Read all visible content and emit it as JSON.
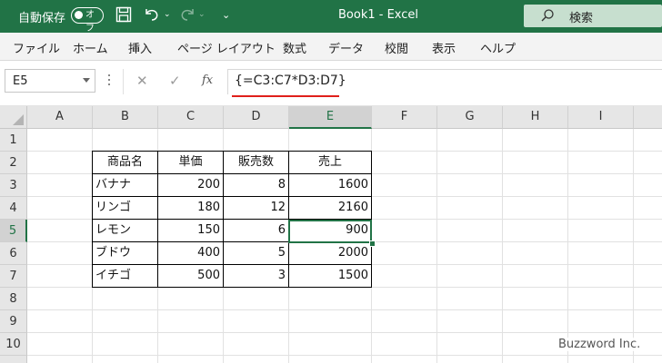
{
  "titlebar": {
    "autosave_label": "自動保存",
    "toggle_state": "オフ",
    "doc_title": "Book1  -  Excel",
    "search_placeholder": "検索"
  },
  "ribbon": {
    "tabs": [
      "ファイル",
      "ホーム",
      "挿入",
      "ページ レイアウト",
      "数式",
      "データ",
      "校閲",
      "表示",
      "ヘルプ"
    ]
  },
  "formula_bar": {
    "name_box": "E5",
    "cancel_icon": "✕",
    "enter_icon": "✓",
    "fx_label": "fx",
    "formula": "{=C3:C7*D3:D7}"
  },
  "grid": {
    "columns": [
      "A",
      "B",
      "C",
      "D",
      "E",
      "F",
      "G",
      "H",
      "I"
    ],
    "rows": [
      "1",
      "2",
      "3",
      "4",
      "5",
      "6",
      "7",
      "8",
      "9",
      "10"
    ],
    "selected_cell": "E5"
  },
  "table": {
    "headers": [
      "商品名",
      "単価",
      "販売数",
      "売上"
    ],
    "rows": [
      [
        "バナナ",
        "200",
        "8",
        "1600"
      ],
      [
        "リンゴ",
        "180",
        "12",
        "2160"
      ],
      [
        "レモン",
        "150",
        "6",
        "900"
      ],
      [
        "ブドウ",
        "400",
        "5",
        "2000"
      ],
      [
        "イチゴ",
        "500",
        "3",
        "1500"
      ]
    ]
  },
  "watermark": "Buzzword Inc.",
  "colors": {
    "excel_green": "#217346",
    "formula_underline": "#e0201b"
  }
}
